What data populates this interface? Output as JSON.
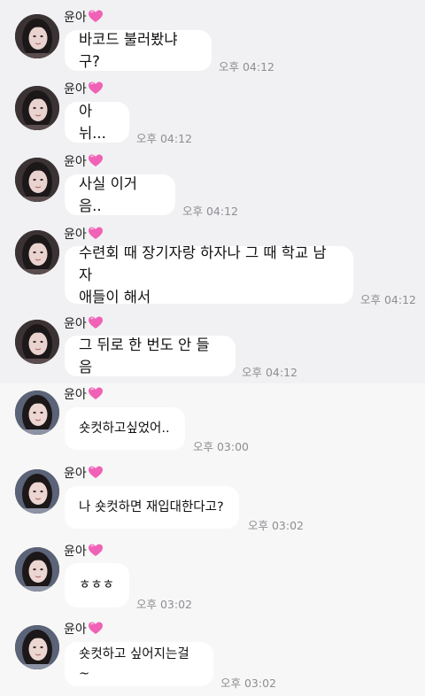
{
  "messages": [
    {
      "sender": "윤아",
      "text": "바코드 불러봤냐구?",
      "time": "오후 04:12"
    },
    {
      "sender": "윤아",
      "text": "아뉘...",
      "time": "오후 04:12"
    },
    {
      "sender": "윤아",
      "text": "사실 이거 음..",
      "time": "오후 04:12"
    },
    {
      "sender": "윤아",
      "text": "수련회 때 장기자랑 하자나 그 때 학교 남자\n애들이 해서",
      "time": "오후 04:12"
    },
    {
      "sender": "윤아",
      "text": "그 뒤로 한 번도 안 들음",
      "time": "오후 04:12"
    },
    {
      "sender": "윤아",
      "text": "숏컷하고싶었어..",
      "time": "오후 03:00"
    },
    {
      "sender": "윤아",
      "text": "나 숏컷하면 재입대한다고?",
      "time": "오후 03:02"
    },
    {
      "sender": "윤아",
      "text": "ㅎㅎㅎ",
      "time": "오후 03:02"
    },
    {
      "sender": "윤아",
      "text": "숏컷하고 싶어지는걸~",
      "time": "오후 03:02"
    }
  ],
  "icons": {
    "name_suffix": "pink-heart-icon",
    "avatar": "profile-photo"
  },
  "colors": {
    "top_background": "#f1f1f3",
    "bottom_background": "#f7f7f7",
    "bubble": "#ffffff",
    "heart": "#f062b6",
    "timestamp": "#8e8e93"
  }
}
